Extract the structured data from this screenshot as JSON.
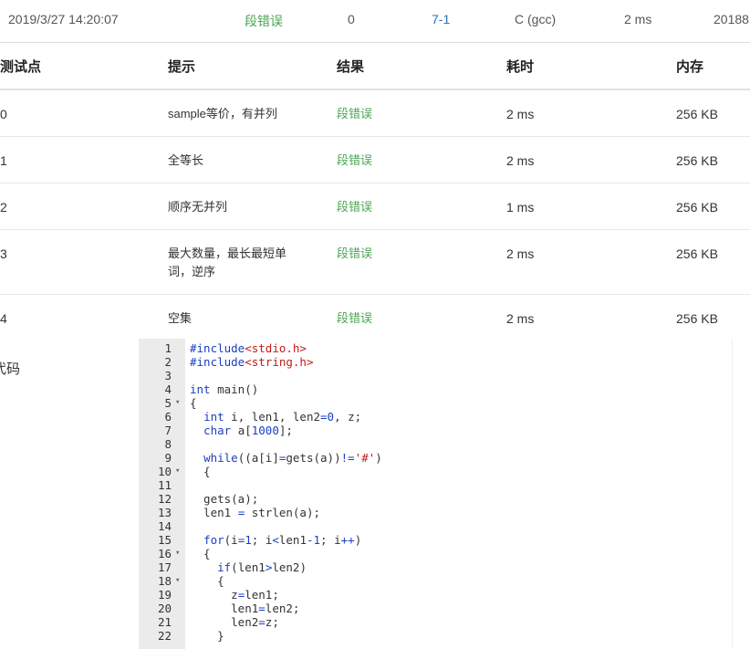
{
  "submission": {
    "time": "2019/3/27 14:20:07",
    "status": "段错误",
    "score": "0",
    "problem": "7-1",
    "compiler": "C (gcc)",
    "duration": "2 ms",
    "user": "20188"
  },
  "table": {
    "headers": [
      "测试点",
      "提示",
      "结果",
      "耗时",
      "内存"
    ],
    "rows": [
      {
        "case": "0",
        "hint": "sample等价，有并列",
        "result": "段错误",
        "time": "2 ms",
        "memory": "256 KB"
      },
      {
        "case": "1",
        "hint": "全等长",
        "result": "段错误",
        "time": "2 ms",
        "memory": "256 KB"
      },
      {
        "case": "2",
        "hint": "顺序无并列",
        "result": "段错误",
        "time": "1 ms",
        "memory": "256 KB"
      },
      {
        "case": "3",
        "hint": "最大数量，最长最短单词，逆序",
        "result": "段错误",
        "time": "2 ms",
        "memory": "256 KB"
      },
      {
        "case": "4",
        "hint": "空集",
        "result": "段错误",
        "time": "2 ms",
        "memory": "256 KB"
      }
    ]
  },
  "code_section": {
    "label": "代码",
    "lines": [
      {
        "n": "1",
        "fold": "",
        "segs": [
          [
            "pp",
            "#include"
          ],
          [
            "str",
            "<stdio.h>"
          ]
        ]
      },
      {
        "n": "2",
        "fold": "",
        "segs": [
          [
            "pp",
            "#include"
          ],
          [
            "str",
            "<string.h>"
          ]
        ]
      },
      {
        "n": "3",
        "fold": "",
        "segs": []
      },
      {
        "n": "4",
        "fold": "",
        "segs": [
          [
            "kw",
            "int"
          ],
          [
            "",
            " main()"
          ]
        ]
      },
      {
        "n": "5",
        "fold": "▾",
        "segs": [
          [
            "",
            "{"
          ]
        ]
      },
      {
        "n": "6",
        "fold": "",
        "segs": [
          [
            "",
            "  "
          ],
          [
            "kw",
            "int"
          ],
          [
            "",
            " i, len1, len2"
          ],
          [
            "op",
            "="
          ],
          [
            "num",
            "0"
          ],
          [
            "",
            ", z;"
          ]
        ]
      },
      {
        "n": "7",
        "fold": "",
        "segs": [
          [
            "",
            "  "
          ],
          [
            "kw",
            "char"
          ],
          [
            "",
            " a["
          ],
          [
            "num",
            "1000"
          ],
          [
            "",
            "];"
          ]
        ]
      },
      {
        "n": "8",
        "fold": "",
        "segs": []
      },
      {
        "n": "9",
        "fold": "",
        "segs": [
          [
            "",
            "  "
          ],
          [
            "kw",
            "while"
          ],
          [
            "",
            "((a[i]"
          ],
          [
            "op",
            "="
          ],
          [
            "",
            "gets(a))"
          ],
          [
            "op",
            "!="
          ],
          [
            "str",
            "'#'"
          ],
          [
            "",
            ")"
          ]
        ]
      },
      {
        "n": "10",
        "fold": "▾",
        "segs": [
          [
            "",
            "  {"
          ]
        ]
      },
      {
        "n": "11",
        "fold": "",
        "segs": []
      },
      {
        "n": "12",
        "fold": "",
        "segs": [
          [
            "",
            "  gets(a);"
          ]
        ]
      },
      {
        "n": "13",
        "fold": "",
        "segs": [
          [
            "",
            "  len1 "
          ],
          [
            "op",
            "="
          ],
          [
            "",
            " strlen(a);"
          ]
        ]
      },
      {
        "n": "14",
        "fold": "",
        "segs": []
      },
      {
        "n": "15",
        "fold": "",
        "segs": [
          [
            "",
            "  "
          ],
          [
            "kw",
            "for"
          ],
          [
            "",
            "(i"
          ],
          [
            "op",
            "="
          ],
          [
            "num",
            "1"
          ],
          [
            "",
            "; i"
          ],
          [
            "op",
            "<"
          ],
          [
            "",
            "len1"
          ],
          [
            "op",
            "-"
          ],
          [
            "num",
            "1"
          ],
          [
            "",
            "; i"
          ],
          [
            "op",
            "++"
          ],
          [
            "",
            ")"
          ]
        ]
      },
      {
        "n": "16",
        "fold": "▾",
        "segs": [
          [
            "",
            "  {"
          ]
        ]
      },
      {
        "n": "17",
        "fold": "",
        "segs": [
          [
            "",
            "    "
          ],
          [
            "kw",
            "if"
          ],
          [
            "",
            "(len1"
          ],
          [
            "op",
            ">"
          ],
          [
            "",
            "len2)"
          ]
        ]
      },
      {
        "n": "18",
        "fold": "▾",
        "segs": [
          [
            "",
            "    {"
          ]
        ]
      },
      {
        "n": "19",
        "fold": "",
        "segs": [
          [
            "",
            "      z"
          ],
          [
            "op",
            "="
          ],
          [
            "",
            "len1;"
          ]
        ]
      },
      {
        "n": "20",
        "fold": "",
        "segs": [
          [
            "",
            "      len1"
          ],
          [
            "op",
            "="
          ],
          [
            "",
            "len2;"
          ]
        ]
      },
      {
        "n": "21",
        "fold": "",
        "segs": [
          [
            "",
            "      len2"
          ],
          [
            "op",
            "="
          ],
          [
            "",
            "z;"
          ]
        ]
      },
      {
        "n": "22",
        "fold": "",
        "segs": [
          [
            "",
            "    }"
          ]
        ]
      }
    ]
  }
}
